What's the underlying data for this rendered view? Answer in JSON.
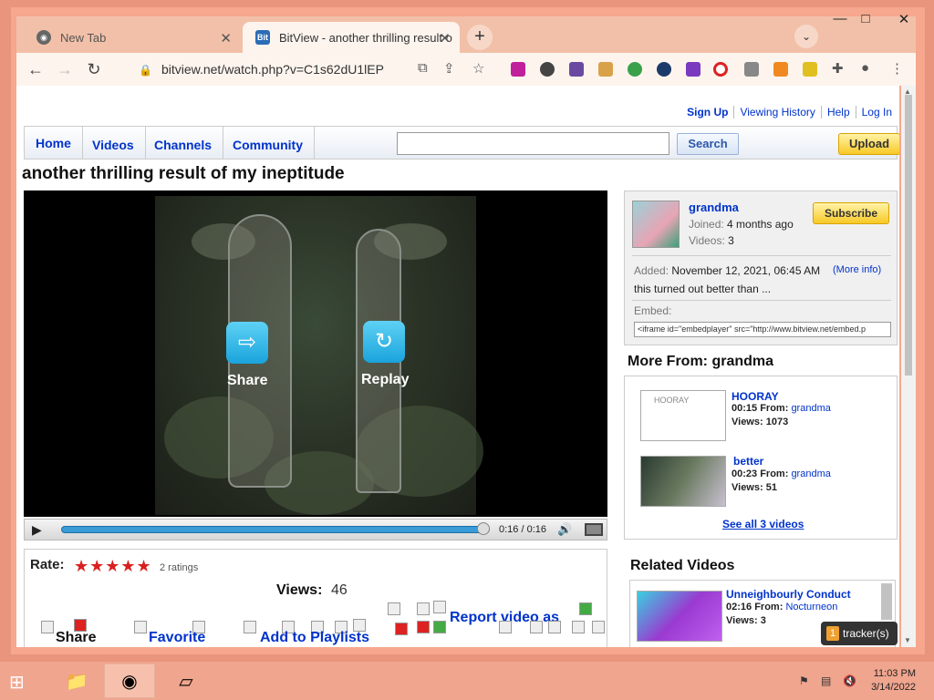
{
  "browser": {
    "tabs": [
      {
        "label": "New Tab",
        "icon": "chrome-icon"
      },
      {
        "label": "BitView - another thrilling result o",
        "icon": "bitview-icon"
      }
    ],
    "url": "bitview.net/watch.php?v=C1s62dU1lEP",
    "colors": {
      "frame": "#f6a78e",
      "toolbar": "#fdf4ee"
    }
  },
  "page": {
    "top_links": [
      "Sign Up",
      "Viewing History",
      "Help",
      "Log In"
    ],
    "nav": [
      "Home",
      "Videos",
      "Channels",
      "Community"
    ],
    "search_button": "Search",
    "upload_button": "Upload",
    "video_title": "another thrilling result of my ineptitude",
    "player": {
      "share_label": "Share",
      "replay_label": "Replay",
      "time": "0:16 / 0:16",
      "progress": 1.0
    },
    "rating": {
      "label": "Rate:",
      "stars": "★★★★★",
      "count": "2 ratings",
      "views_label": "Views:",
      "views_value": "46"
    },
    "actions": [
      "Share",
      "Favorite",
      "Add to Playlists",
      "Report video as"
    ],
    "uploader": {
      "name": "grandma",
      "joined_label": "Joined:",
      "joined_value": "4 months ago",
      "videos_label": "Videos:",
      "videos_value": "3",
      "subscribe": "Subscribe",
      "added_label": "Added:",
      "added_value": "November 12, 2021, 06:45 AM",
      "more_info": "(More info)",
      "description": "this turned out better than ...",
      "embed_label": "Embed:",
      "embed_code": "<iframe id=\"embedplayer\" src=\"http://www.bitview.net/embed.p"
    },
    "more_from": {
      "title": "More From: grandma",
      "videos": [
        {
          "title": "HOORAY",
          "duration": "00:15",
          "from_label": "From:",
          "author": "grandma",
          "views_label": "Views:",
          "views": "1073",
          "thumb_alt": "HOORAY"
        },
        {
          "title": "better",
          "duration": "00:23",
          "from_label": "From:",
          "author": "grandma",
          "views_label": "Views:",
          "views": "51"
        }
      ],
      "see_all": "See all 3 videos"
    },
    "related": {
      "title": "Related Videos",
      "videos": [
        {
          "title": "Unneighbourly Conduct",
          "duration": "02:16",
          "from_label": "From:",
          "author": "Nocturneon",
          "views_label": "Views:",
          "views": "3"
        }
      ]
    },
    "tracker": {
      "count": "1",
      "label": "tracker(s)"
    }
  },
  "taskbar": {
    "time": "11:03 PM",
    "date": "3/14/2022"
  }
}
